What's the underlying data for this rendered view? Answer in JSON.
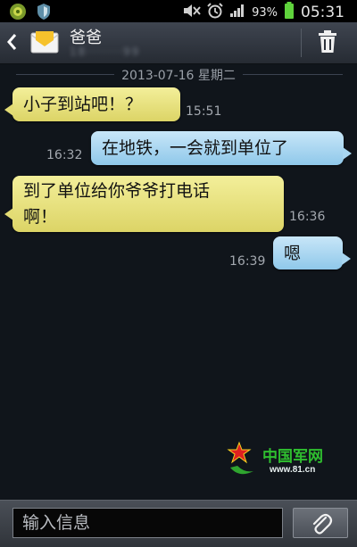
{
  "status_bar": {
    "battery_percent": "93%",
    "clock": "05:31",
    "icons": [
      "notification-icon",
      "shield-icon",
      "mute-icon",
      "alarm-icon",
      "signal-icon",
      "battery-icon"
    ]
  },
  "header": {
    "contact_name": "爸爸",
    "contact_number": "18·······99",
    "back_icon": "back-icon",
    "delete_icon": "trash-icon"
  },
  "conversation": {
    "date": "2013-07-16 星期二",
    "messages": [
      {
        "direction": "incoming",
        "text": "小子到站吧！？",
        "time": "15:51"
      },
      {
        "direction": "outgoing",
        "text": "在地铁，一会就到单位了",
        "time": "16:32"
      },
      {
        "direction": "incoming",
        "text_line1": "到了单位给你爷爷打电话",
        "text_line2": "啊！",
        "time": "16:36"
      },
      {
        "direction": "outgoing",
        "text": "嗯",
        "time": "16:39"
      }
    ]
  },
  "watermark": {
    "name": "中国军网",
    "url": "www.81.cn"
  },
  "input_bar": {
    "placeholder": "输入信息",
    "attach_icon": "paperclip-icon"
  },
  "colors": {
    "incoming_bubble": "#e8e27c",
    "outgoing_bubble": "#a9d7f2",
    "background": "#10151b"
  }
}
